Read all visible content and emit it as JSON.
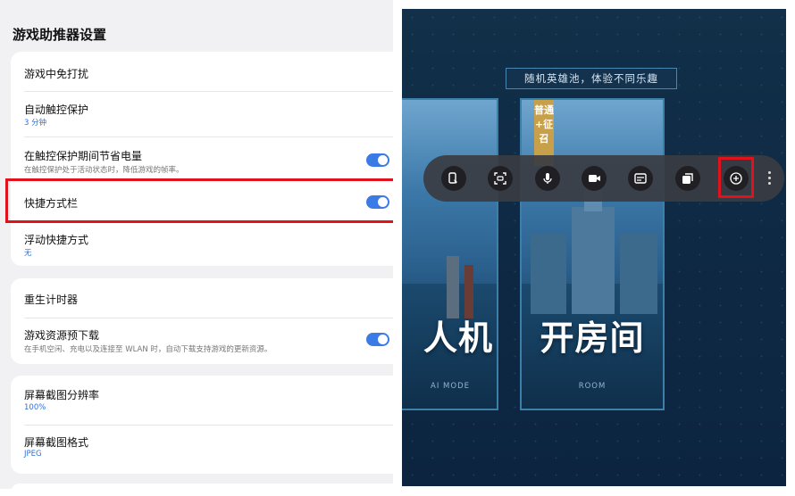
{
  "settings": {
    "title": "游戏助推器设置",
    "items": [
      {
        "label": "游戏中免打扰"
      },
      {
        "label": "自动触控保护",
        "value": "3 分钟"
      },
      {
        "label": "在触控保护期间节省电量",
        "subtitle": "在触控保护处于活动状态时，降低游戏的帧率。",
        "toggle": "on"
      },
      {
        "label": "快捷方式栏",
        "toggle": "on"
      },
      {
        "label": "浮动快捷方式",
        "value": "无"
      },
      {
        "label": "重生计时器"
      },
      {
        "label": "游戏资源预下载",
        "subtitle": "在手机空闲、充电以及连接至 WLAN 时，自动下载支持游戏的更新资源。",
        "toggle": "on"
      },
      {
        "label": "屏幕截图分辨率",
        "value": "100%"
      },
      {
        "label": "屏幕截图格式",
        "value": "JPEG"
      }
    ]
  },
  "game": {
    "banner": "随机英雄池，体验不同乐趣",
    "cards": [
      {
        "title": "人机",
        "subtitle": "AI MODE"
      },
      {
        "title": "开房间",
        "subtitle": "ROOM",
        "ribbon": "普通+征召"
      }
    ],
    "toolbar": {
      "icons": [
        "touch-protect-icon",
        "screenshot-icon",
        "microphone-icon",
        "video-record-icon",
        "shortcut-panel-icon",
        "window-icon",
        "game-booster-icon",
        "more-icon"
      ]
    }
  },
  "colors": {
    "accent": "#3b7be6",
    "highlight": "#e0121b"
  }
}
